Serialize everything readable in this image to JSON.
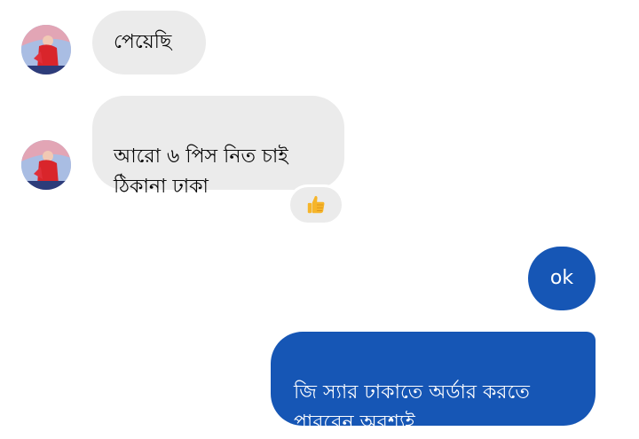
{
  "messages": [
    {
      "direction": "incoming",
      "text": "পেয়েছি"
    },
    {
      "direction": "incoming",
      "text": "আরো ৬ পিস নিত চাই\nঠিকানা ঢাকা",
      "reaction": "thumbs-up-icon"
    },
    {
      "direction": "outgoing",
      "text": "ok"
    },
    {
      "direction": "outgoing",
      "text": "জি স্যার ঢাকাতে অর্ডার করতে\nপারবেন অবশ্যই"
    }
  ],
  "colors": {
    "incoming_bubble": "#ebebeb",
    "outgoing_bubble": "#1656b5",
    "outgoing_text": "#ffffff"
  }
}
